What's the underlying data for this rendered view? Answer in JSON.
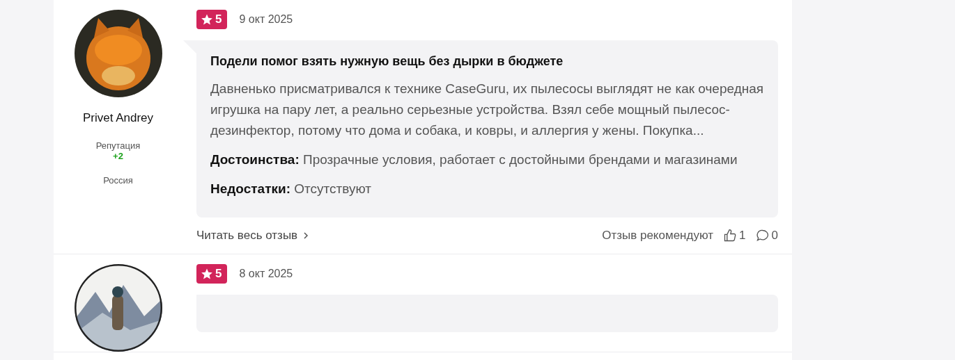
{
  "reviews": [
    {
      "author": "Privet Andrey",
      "reputation_label": "Репутация",
      "reputation": "+2",
      "country": "Россия",
      "rating": "5",
      "date": "9 окт 2025",
      "title": "Подели помог взять нужную вещь без дырки в бюджете",
      "text": "Давненько присматривался к технике CaseGuru, их пылесосы выглядят не как очередная игрушка на пару лет, а реально серьезные устройства. Взял себе мощный пылесос-дезинфектор, потому что дома и собака, и ковры, и аллергия у жены. Покупка...",
      "pros": "**Достоинства:** Прозрачные условия, работает с достойными брендами и магазинами",
      "cons": "**Недостатки:** Отсутствуют",
      "read_more": "Читать весь отзыв",
      "recommend_label": "Отзыв рекомендуют",
      "likes": "1",
      "comments": "0"
    },
    {
      "rating": "5",
      "date": "8 окт 2025"
    }
  ]
}
